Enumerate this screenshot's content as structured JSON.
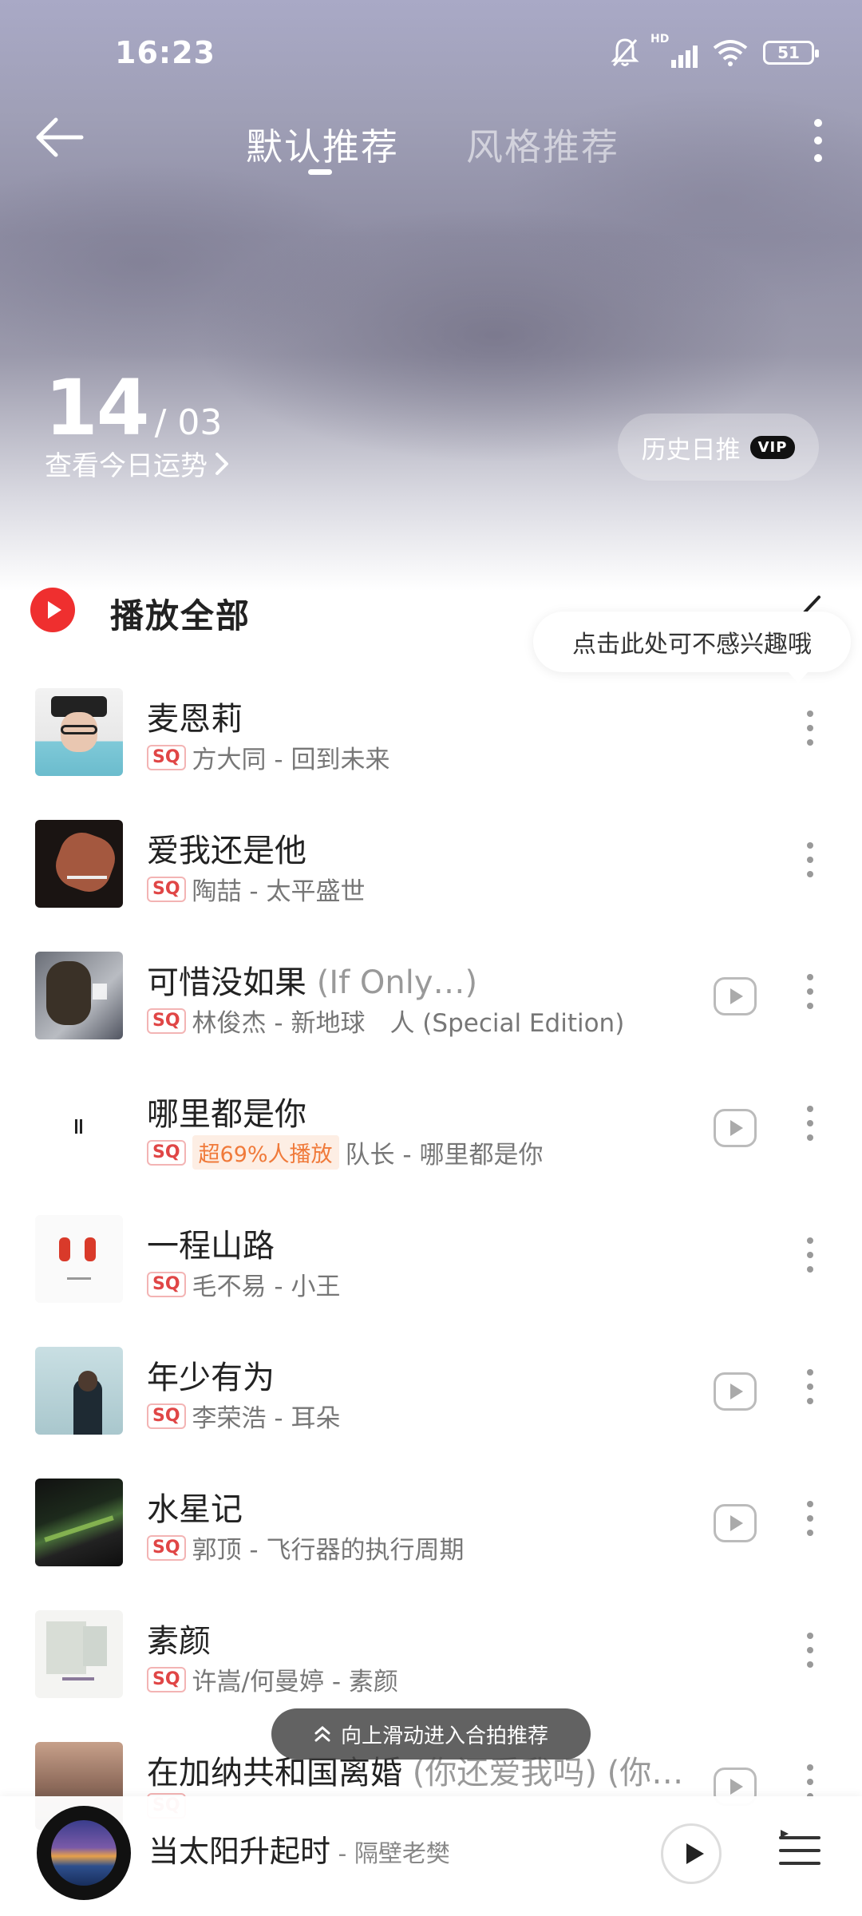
{
  "status_bar": {
    "time": "16:23",
    "battery": "51",
    "network": "HD"
  },
  "header": {
    "tabs": [
      {
        "label": "默认推荐",
        "active": true
      },
      {
        "label": "风格推荐",
        "active": false
      }
    ]
  },
  "date": {
    "day": "14",
    "month": "/ 03"
  },
  "fortune_link": "查看今日运势",
  "history_button": {
    "label": "历史日推",
    "badge": "VIP"
  },
  "play_all_label": "播放全部",
  "tooltip": "点击此处可不感兴趣哦",
  "songs": [
    {
      "title": "麦恩莉",
      "subtitle": "",
      "quality": "SQ",
      "hot": "",
      "artist_album": "方大同 - 回到未来",
      "has_mv": false
    },
    {
      "title": "爱我还是他",
      "subtitle": "",
      "quality": "SQ",
      "hot": "",
      "artist_album": "陶喆 - 太平盛世",
      "has_mv": false
    },
    {
      "title": "可惜没如果",
      "subtitle": " (If Only…)",
      "quality": "SQ",
      "hot": "",
      "artist_album": "林俊杰 - 新地球　人 (Special Edition)",
      "has_mv": true
    },
    {
      "title": "哪里都是你",
      "subtitle": "",
      "quality": "SQ",
      "hot": "超69%人播放",
      "artist_album": "队长 - 哪里都是你",
      "has_mv": true
    },
    {
      "title": "一程山路",
      "subtitle": "",
      "quality": "SQ",
      "hot": "",
      "artist_album": "毛不易 - 小王",
      "has_mv": false
    },
    {
      "title": "年少有为",
      "subtitle": "",
      "quality": "SQ",
      "hot": "",
      "artist_album": "李荣浩 - 耳朵",
      "has_mv": true
    },
    {
      "title": "水星记",
      "subtitle": "",
      "quality": "SQ",
      "hot": "",
      "artist_album": "郭顶 - 飞行器的执行周期",
      "has_mv": true
    },
    {
      "title": "素颜",
      "subtitle": "",
      "quality": "SQ",
      "hot": "",
      "artist_album": "许嵩/何曼婷 - 素颜",
      "has_mv": false
    },
    {
      "title": "在加纳共和国离婚",
      "subtitle": " (你还爱我吗) (你…",
      "quality": "SQ",
      "hot": "",
      "artist_album": "",
      "has_mv": true
    }
  ],
  "toast": "向上滑动进入合拍推荐",
  "mini_player": {
    "title": "当太阳升起时",
    "artist": " - 隔壁老樊"
  },
  "colors": {
    "accent_red": "#ef2f2f",
    "hot_orange": "#f07a3a"
  }
}
